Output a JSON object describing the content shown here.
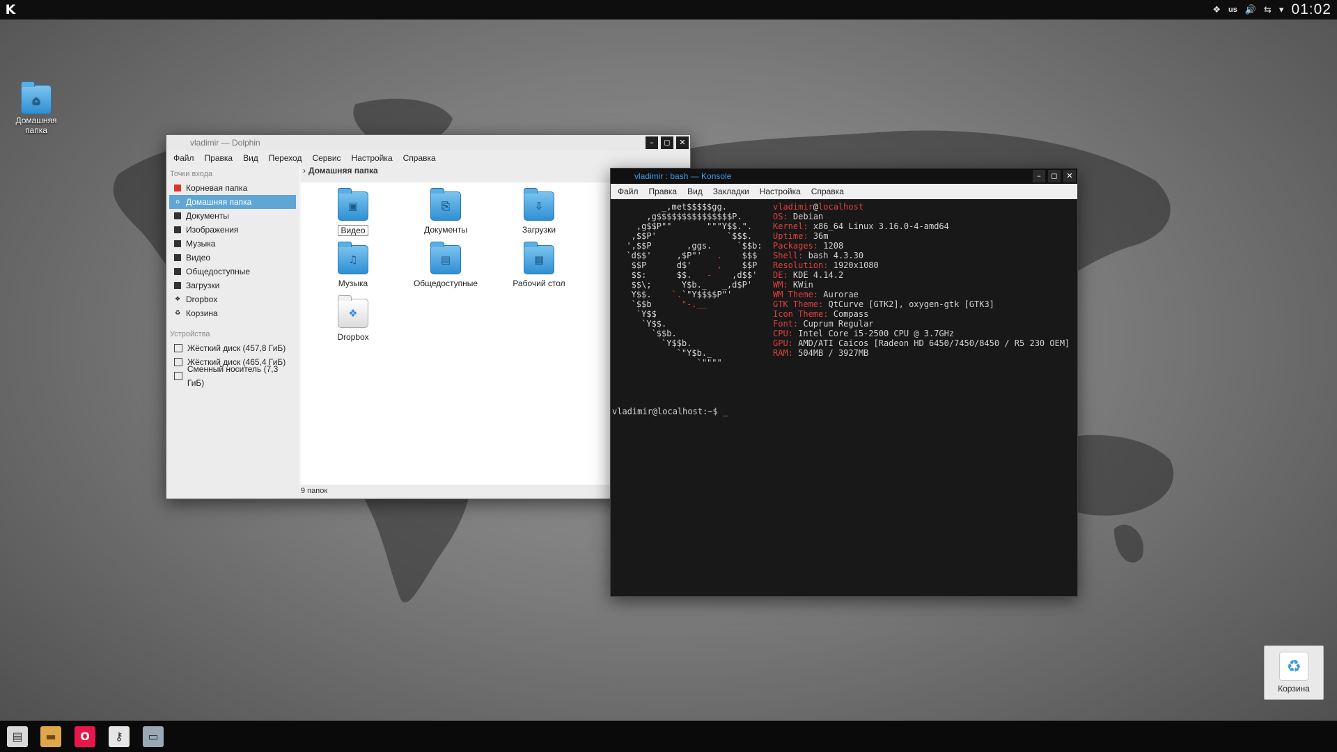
{
  "top_panel": {
    "keyboard_layout": "us",
    "clock": "01:02",
    "icons": [
      "kde-logo",
      "dropbox-icon",
      "volume-icon",
      "network-icon",
      "tray-expand-icon"
    ]
  },
  "desktop": {
    "home_icon_label_line1": "Домашняя",
    "home_icon_label_line2": "папка",
    "trash_widget_label": "Корзина"
  },
  "dolphin": {
    "title": "vladimir — Dolphin",
    "menu": [
      "Файл",
      "Правка",
      "Вид",
      "Переход",
      "Сервис",
      "Настройка",
      "Справка"
    ],
    "places_header": "Точки входа",
    "places": [
      {
        "label": "Корневая папка",
        "icon": "root-folder-icon"
      },
      {
        "label": "Домашняя папка",
        "icon": "home-icon"
      },
      {
        "label": "Документы",
        "icon": "documents-icon"
      },
      {
        "label": "Изображения",
        "icon": "images-icon"
      },
      {
        "label": "Музыка",
        "icon": "music-icon"
      },
      {
        "label": "Видео",
        "icon": "video-icon"
      },
      {
        "label": "Общедоступные",
        "icon": "public-icon"
      },
      {
        "label": "Загрузки",
        "icon": "downloads-icon"
      },
      {
        "label": "Dropbox",
        "icon": "dropbox-icon"
      },
      {
        "label": "Корзина",
        "icon": "trash-icon"
      }
    ],
    "devices_header": "Устройства",
    "devices": [
      {
        "label": "Жёсткий диск (457,8 ГиБ)",
        "icon": "hard-disk-icon"
      },
      {
        "label": "Жёсткий диск (465,4 ГиБ)",
        "icon": "hard-disk-icon"
      },
      {
        "label": "Сменный носитель (7,3 ГиБ)",
        "icon": "removable-drive-icon"
      }
    ],
    "breadcrumb": "Домашняя папка",
    "items": [
      {
        "label": "Видео",
        "icon": "video-folder-icon"
      },
      {
        "label": "Документы",
        "icon": "documents-folder-icon"
      },
      {
        "label": "Загрузки",
        "icon": "downloads-folder-icon"
      },
      {
        "label": "Музыка",
        "icon": "music-folder-icon"
      },
      {
        "label": "Общедоступные",
        "icon": "public-folder-icon"
      },
      {
        "label": "Рабочий стол",
        "icon": "desktop-folder-icon"
      },
      {
        "label": "Dropbox",
        "icon": "dropbox-folder-icon"
      }
    ],
    "status": "9 папок"
  },
  "konsole": {
    "title": "vladimir : bash — Konsole",
    "menu": [
      "Файл",
      "Правка",
      "Вид",
      "Закладки",
      "Настройка",
      "Справка"
    ],
    "user": "vladimir",
    "at": "@",
    "host": "localhost",
    "info": [
      {
        "key": "OS:",
        "value": "Debian"
      },
      {
        "key": "Kernel:",
        "value": "x86_64 Linux 3.16.0-4-amd64"
      },
      {
        "key": "Uptime:",
        "value": "36m"
      },
      {
        "key": "Packages:",
        "value": "1208"
      },
      {
        "key": "Shell:",
        "value": "bash 4.3.30"
      },
      {
        "key": "Resolution:",
        "value": "1920x1080"
      },
      {
        "key": "DE:",
        "value": "KDE 4.14.2"
      },
      {
        "key": "WM:",
        "value": "KWin"
      },
      {
        "key": "WM Theme:",
        "value": "Aurorae"
      },
      {
        "key": "GTK Theme:",
        "value": "QtCurve [GTK2], oxygen-gtk [GTK3]"
      },
      {
        "key": "Icon Theme:",
        "value": "Compass"
      },
      {
        "key": "Font:",
        "value": "Cuprum Regular"
      },
      {
        "key": "CPU:",
        "value": "Intel Core i5-2500 CPU @ 3.7GHz"
      },
      {
        "key": "GPU:",
        "value": "AMD/ATI Caicos [Radeon HD 6450/7450/8450 / R5 230 OEM]"
      },
      {
        "key": "RAM:",
        "value": "504MB / 3927MB"
      }
    ],
    "prompt": "vladimir@localhost:~$ _"
  },
  "taskbar": {
    "launchers": [
      {
        "icon": "system-monitor-icon",
        "color": "#d9d9d9"
      },
      {
        "icon": "file-manager-icon",
        "color": "#e0a64a"
      },
      {
        "icon": "opera-icon",
        "color": "#e8174a"
      },
      {
        "icon": "keys-icon",
        "color": "#e6e6e6"
      },
      {
        "icon": "terminal-icon",
        "color": "#9aa7b4"
      }
    ]
  }
}
